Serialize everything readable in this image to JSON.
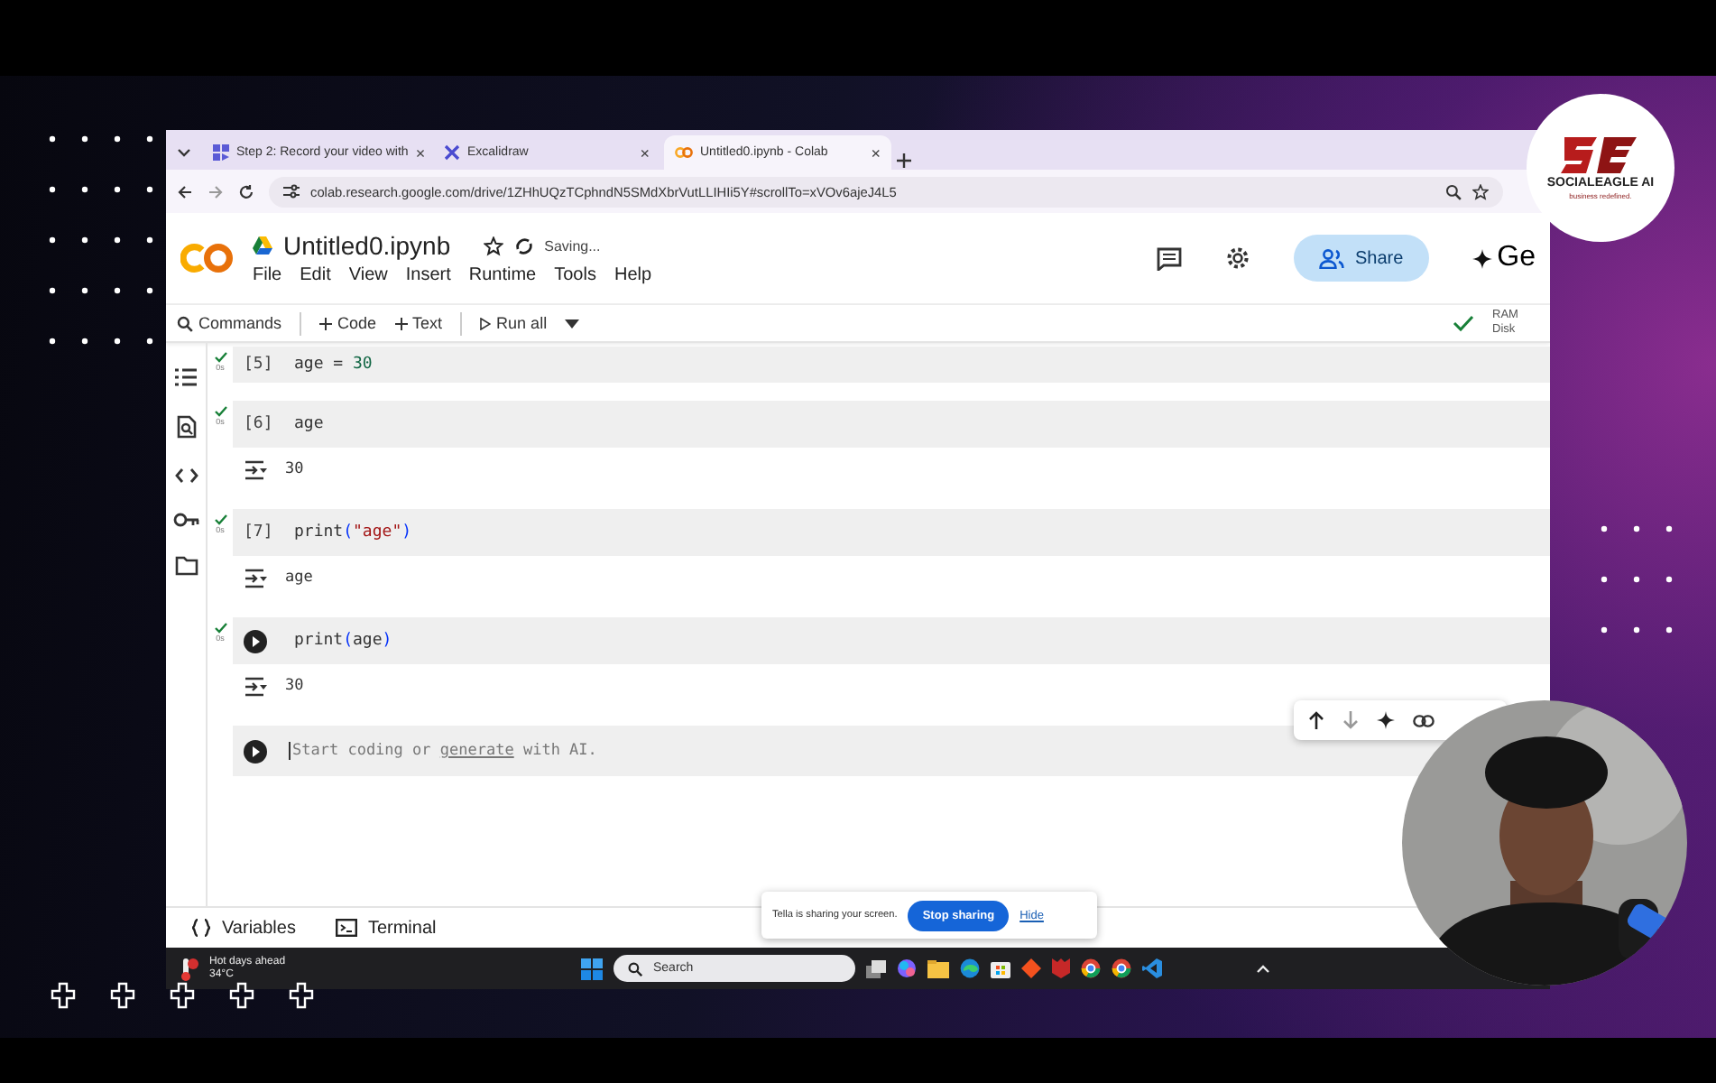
{
  "browser": {
    "tabs": [
      {
        "title": "Step 2: Record your video with",
        "close": "×",
        "selected": false
      },
      {
        "title": "Excalidraw",
        "close": "×",
        "selected": false
      },
      {
        "title": "Untitled0.ipynb - Colab",
        "close": "×",
        "selected": true
      }
    ],
    "url": "colab.research.google.com/drive/1ZHhUQzTCphndN5SMdXbrVutLLIHIi5Y#scrollTo=xVOv6ajeJ4L5"
  },
  "notebook": {
    "title": "Untitled0.ipynb",
    "save_status": "Saving...",
    "menu": [
      "File",
      "Edit",
      "View",
      "Insert",
      "Runtime",
      "Tools",
      "Help"
    ],
    "share": "Share",
    "gemini": "Ge",
    "commands": "Commands",
    "add_code": "Code",
    "add_text": "Text",
    "run_all": "Run all",
    "resources": [
      "RAM",
      "Disk"
    ],
    "cells": [
      {
        "kind": "counter",
        "counter": "[5]",
        "time": "0s",
        "code": [
          {
            "text": "age = ",
            "kind": "plain"
          },
          {
            "text": "30",
            "kind": "number"
          }
        ]
      },
      {
        "kind": "counter",
        "counter": "[6]",
        "time": "0s",
        "code": [
          {
            "text": "age",
            "kind": "plain"
          }
        ],
        "output": "30"
      },
      {
        "kind": "counter",
        "counter": "[7]",
        "time": "0s",
        "code": [
          {
            "text": "print",
            "kind": "plain"
          },
          {
            "text": "(",
            "kind": "paren"
          },
          {
            "text": "\"age\"",
            "kind": "string"
          },
          {
            "text": ")",
            "kind": "paren"
          }
        ],
        "output": "age"
      },
      {
        "kind": "run",
        "time": "0s",
        "code": [
          {
            "text": "print",
            "kind": "plain"
          },
          {
            "text": "(",
            "kind": "paren"
          },
          {
            "text": "age",
            "kind": "plain"
          },
          {
            "text": ")",
            "kind": "paren"
          }
        ],
        "output": "30"
      }
    ],
    "new_cell": {
      "before": "Start coding or ",
      "link": "generate",
      "after": " with AI."
    },
    "bottom_tabs": [
      "Variables",
      "Terminal"
    ]
  },
  "sharing_bar": {
    "message": "Tella is sharing your screen.",
    "stop": "Stop sharing",
    "hide": "Hide"
  },
  "taskbar": {
    "weather_title": "Hot days ahead",
    "temperature": "34°C",
    "search": "Search"
  },
  "logo": {
    "name": "SOCIALEAGLE AI",
    "tagline": "business redefined."
  }
}
